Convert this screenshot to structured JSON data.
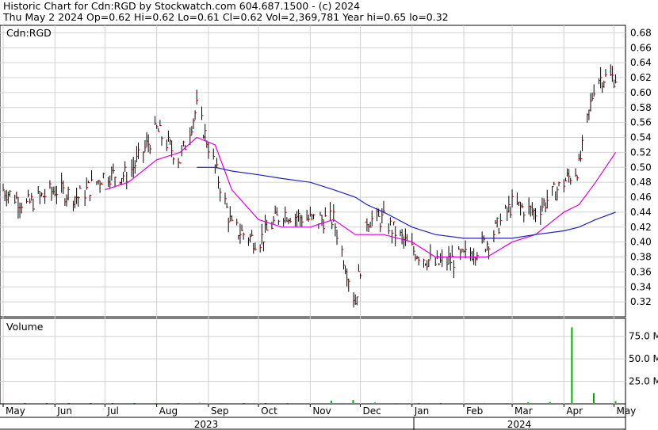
{
  "header": {
    "line1": "Historic Chart for Cdn:RGD by Stockwatch.com 604.687.1500 - (c) 2024",
    "line2": "Thu May  2 2024  Op=0.62  Hi=0.62  Lo=0.61  Cl=0.62  Vol=2,369,781  Year hi=0.65  lo=0.32"
  },
  "chart_data": {
    "type": "line",
    "symbol_label": "Cdn:RGD",
    "volume_label": "Volume",
    "price_axis": {
      "ylim": [
        0.3,
        0.69
      ],
      "ticks": [
        "0.68",
        "0.66",
        "0.64",
        "0.62",
        "0.60",
        "0.58",
        "0.56",
        "0.54",
        "0.52",
        "0.50",
        "0.48",
        "0.46",
        "0.44",
        "0.42",
        "0.40",
        "0.38",
        "0.36",
        "0.34",
        "0.32"
      ]
    },
    "volume_axis": {
      "ylim": [
        0,
        95
      ],
      "ticks": [
        "75.0 M",
        "50.0 M",
        "25.0 M"
      ]
    },
    "months": [
      "May",
      "Jun",
      "Jul",
      "Aug",
      "Sep",
      "Oct",
      "Nov",
      "Dec",
      "Jan",
      "Feb",
      "Mar",
      "Apr",
      "May"
    ],
    "years": [
      "2023",
      "2024"
    ],
    "x": [
      "2023-05-01",
      "2023-05-15",
      "2023-06-01",
      "2023-06-15",
      "2023-07-01",
      "2023-07-15",
      "2023-08-01",
      "2023-08-15",
      "2023-08-25",
      "2023-09-05",
      "2023-09-15",
      "2023-10-01",
      "2023-10-15",
      "2023-11-01",
      "2023-11-15",
      "2023-11-28",
      "2023-12-05",
      "2023-12-15",
      "2024-01-01",
      "2024-01-15",
      "2024-02-01",
      "2024-02-15",
      "2024-03-01",
      "2024-03-15",
      "2024-04-01",
      "2024-04-10",
      "2024-04-20",
      "2024-05-02"
    ],
    "series": [
      {
        "values": [
          0.47,
          0.45,
          0.47,
          0.46,
          0.49,
          0.49,
          0.55,
          0.51,
          0.58,
          0.5,
          0.42,
          0.4,
          0.44,
          0.43,
          0.43,
          0.32,
          0.43,
          0.43,
          0.39,
          0.37,
          0.38,
          0.4,
          0.45,
          0.44,
          0.48,
          0.5,
          0.62,
          0.62
        ]
      },
      {
        "values": [
          null,
          null,
          null,
          null,
          0.47,
          0.48,
          0.51,
          0.52,
          0.54,
          0.53,
          0.47,
          0.43,
          0.42,
          0.42,
          0.43,
          0.41,
          0.41,
          0.41,
          0.4,
          0.38,
          0.38,
          0.38,
          0.4,
          0.41,
          0.44,
          0.45,
          0.48,
          0.52
        ]
      },
      {
        "values": [
          null,
          null,
          null,
          null,
          null,
          null,
          null,
          null,
          0.5,
          0.5,
          0.495,
          0.49,
          0.485,
          0.48,
          0.47,
          0.46,
          0.45,
          0.44,
          0.42,
          0.41,
          0.405,
          0.405,
          0.405,
          0.41,
          0.415,
          0.42,
          0.43,
          0.44
        ]
      }
    ],
    "volume_values": [
      0.4,
      0.3,
      0.5,
      0.4,
      0.4,
      0.5,
      0.4,
      0.3,
      0.6,
      1.2,
      0.8,
      0.5,
      0.4,
      0.6,
      0.9,
      3.5,
      4.2,
      1.5,
      0.8,
      0.6,
      0.6,
      0.9,
      1.0,
      0.8,
      1.8,
      2.0,
      85,
      12,
      3
    ]
  }
}
